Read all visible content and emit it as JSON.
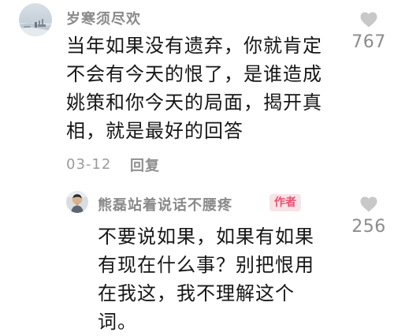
{
  "main_comment": {
    "username": "岁寒须尽欢",
    "text": "当年如果没有遗弃，你就肯定\n不会有今天的恨了，是谁造成\n姚策和你今天的局面，揭开真\n相，就是最好的回答",
    "date": "03-12",
    "reply_label": "回复",
    "likes": "767"
  },
  "reply_comment": {
    "username": "熊磊站着说话不腰疼",
    "badge": "作者",
    "text": "不要说如果，如果有如果\n有现在什么事？别把恨用\n在我这，我不理解这个\n词。",
    "likes": "256"
  },
  "icons": {
    "like": "heart-icon"
  },
  "colors": {
    "text_primary": "#161616",
    "text_secondary": "#8a8a8a",
    "badge_bg": "#f8e3e7",
    "badge_text": "#f04c6d",
    "heart": "#c8c8c8"
  }
}
